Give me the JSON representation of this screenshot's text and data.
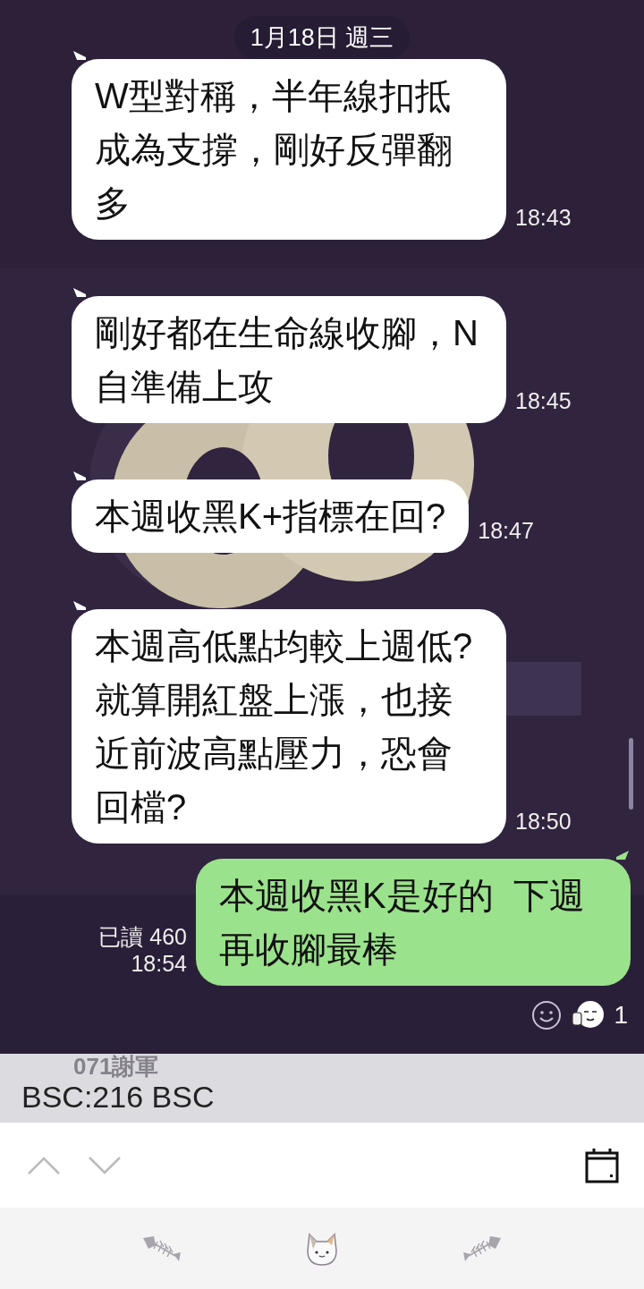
{
  "date_divider": "1月18日 週三",
  "messages": [
    {
      "kind": "incoming",
      "text": "W型對稱，半年線扣抵成為支撐，剛好反彈翻多",
      "time": "18:43"
    },
    {
      "kind": "incoming",
      "text": "剛好都在生命線收腳，N自準備上攻",
      "time": "18:45"
    },
    {
      "kind": "incoming",
      "text": "本週收黑K+指標在回?",
      "time": "18:47"
    },
    {
      "kind": "incoming",
      "text": "本週高低點均較上週低?就算開紅盤上漲，也接近前波高點壓力，恐會回檔?",
      "time": "18:50"
    },
    {
      "kind": "outgoing",
      "text": "本週收黑K是好的  下週再收腳最棒",
      "read": "已讀 460",
      "time": "18:54"
    }
  ],
  "reactions": {
    "count": "1"
  },
  "search_result": {
    "sender": "071謝軍",
    "text": "BSC:216 BSC"
  }
}
